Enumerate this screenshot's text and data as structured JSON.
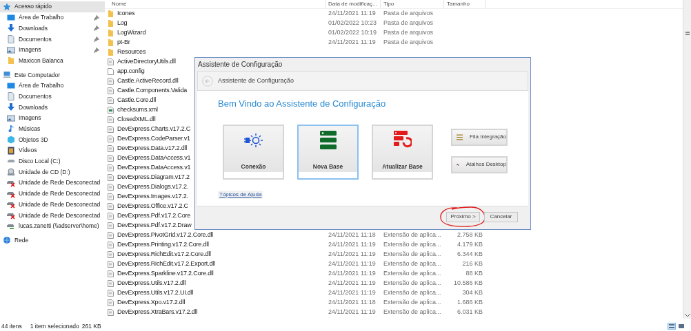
{
  "sidebar": {
    "items": [
      {
        "label": "Acesso rápido",
        "kind": "star",
        "selected": true,
        "children": [
          {
            "label": "Área de Trabalho",
            "kind": "desktop",
            "pinned": true,
            "selected": false
          },
          {
            "label": "Downloads",
            "kind": "download",
            "pinned": true,
            "selected": false
          },
          {
            "label": "Documentos",
            "kind": "document",
            "pinned": true,
            "selected": false
          },
          {
            "label": "Imagens",
            "kind": "image",
            "pinned": true,
            "selected": false
          },
          {
            "label": "Maxicon Balanca",
            "kind": "folder",
            "pinned": false,
            "selected": false
          }
        ]
      },
      {
        "label": "Este Computador",
        "kind": "computer",
        "selected": false,
        "children": [
          {
            "label": "Área de Trabalho",
            "kind": "desktop",
            "selected": false
          },
          {
            "label": "Documentos",
            "kind": "document",
            "selected": false
          },
          {
            "label": "Downloads",
            "kind": "download",
            "selected": false
          },
          {
            "label": "Imagens",
            "kind": "image",
            "selected": false
          },
          {
            "label": "Músicas",
            "kind": "music",
            "selected": false
          },
          {
            "label": "Objetos 3D",
            "kind": "cube",
            "selected": false
          },
          {
            "label": "Vídeos",
            "kind": "video",
            "selected": false
          },
          {
            "label": "Disco Local (C:)",
            "kind": "disk",
            "selected": false
          },
          {
            "label": "Unidade de CD (D:)",
            "kind": "cd",
            "selected": false
          },
          {
            "label": "Unidade de Rede Desconectad",
            "kind": "netdrive-off",
            "selected": false
          },
          {
            "label": "Unidade de Rede Desconectad",
            "kind": "netdrive-off",
            "selected": false
          },
          {
            "label": "Unidade de Rede Desconectad",
            "kind": "netdrive-off",
            "selected": false
          },
          {
            "label": "Unidade de Rede Desconectad",
            "kind": "netdrive-off",
            "selected": false
          },
          {
            "label": "lucas.zanetti (\\\\adserver\\home)",
            "kind": "netdrive",
            "selected": false
          }
        ]
      },
      {
        "label": "Rede",
        "kind": "network",
        "selected": false
      }
    ]
  },
  "table": {
    "columns": [
      "Nome",
      "Data de modificaç...",
      "Tipo",
      "Tamanho"
    ],
    "rows": [
      {
        "kind": "folder",
        "name": "Icones",
        "date": "24/11/2021 11:19",
        "type": "Pasta de arquivos"
      },
      {
        "kind": "folder",
        "name": "Log",
        "date": "01/02/2022 10:23",
        "type": "Pasta de arquivos"
      },
      {
        "kind": "folder",
        "name": "LogWizard",
        "date": "01/02/2022 10:19",
        "type": "Pasta de arquivos"
      },
      {
        "kind": "folder",
        "name": "pt-Br",
        "date": "24/11/2021 11:19",
        "type": "Pasta de arquivos"
      },
      {
        "kind": "folder",
        "name": "Resources"
      },
      {
        "kind": "dll",
        "name": "ActiveDirectoryUtils.dll"
      },
      {
        "kind": "file",
        "name": "app.config"
      },
      {
        "kind": "dll",
        "name": "Castle.ActiveRecord.dll"
      },
      {
        "kind": "dll",
        "name": "Castle.Components.Valida"
      },
      {
        "kind": "dll",
        "name": "Castle.Core.dll"
      },
      {
        "kind": "xml",
        "name": "checksums.xml"
      },
      {
        "kind": "dll",
        "name": "ClosedXML.dll"
      },
      {
        "kind": "dll",
        "name": "DevExpress.Charts.v17.2.C"
      },
      {
        "kind": "dll",
        "name": "DevExpress.CodeParser.v1"
      },
      {
        "kind": "dll",
        "name": "DevExpress.Data.v17.2.dll"
      },
      {
        "kind": "dll",
        "name": "DevExpress.DataAccess.v1"
      },
      {
        "kind": "dll",
        "name": "DevExpress.DataAccess.v1"
      },
      {
        "kind": "dll",
        "name": "DevExpress.Diagram.v17.2"
      },
      {
        "kind": "dll",
        "name": "DevExpress.Dialogs.v17.2."
      },
      {
        "kind": "dll",
        "name": "DevExpress.Images.v17.2."
      },
      {
        "kind": "dll",
        "name": "DevExpress.Office.v17.2.C"
      },
      {
        "kind": "dll",
        "name": "DevExpress.Pdf.v17.2.Core"
      },
      {
        "kind": "dll",
        "name": "DevExpress.Pdf.v17.2.Draw"
      },
      {
        "kind": "dll",
        "name": "DevExpress.PivotGrid.v17.2.Core.dll",
        "date": "24/11/2021 11:18",
        "type": "Extensão de aplica...",
        "size": "2.758 KB"
      },
      {
        "kind": "dll",
        "name": "DevExpress.Printing.v17.2.Core.dll",
        "date": "24/11/2021 11:19",
        "type": "Extensão de aplica...",
        "size": "4.179 KB"
      },
      {
        "kind": "dll",
        "name": "DevExpress.RichEdit.v17.2.Core.dll",
        "date": "24/11/2021 11:19",
        "type": "Extensão de aplica...",
        "size": "6.344 KB"
      },
      {
        "kind": "dll",
        "name": "DevExpress.RichEdit.v17.2.Export.dll",
        "date": "24/11/2021 11:19",
        "type": "Extensão de aplica...",
        "size": "216 KB"
      },
      {
        "kind": "dll",
        "name": "DevExpress.Sparkline.v17.2.Core.dll",
        "date": "24/11/2021 11:19",
        "type": "Extensão de aplica...",
        "size": "88 KB"
      },
      {
        "kind": "dll",
        "name": "DevExpress.Utils.v17.2.dll",
        "date": "24/11/2021 11:19",
        "type": "Extensão de aplica...",
        "size": "10.586 KB"
      },
      {
        "kind": "dll",
        "name": "DevExpress.Utils.v17.2.UI.dll",
        "date": "24/11/2021 11:19",
        "type": "Extensão de aplica...",
        "size": "304 KB"
      },
      {
        "kind": "dll",
        "name": "DevExpress.Xpo.v17.2.dll",
        "date": "24/11/2021 11:18",
        "type": "Extensão de aplica...",
        "size": "1.686 KB"
      },
      {
        "kind": "dll",
        "name": "DevExpress.XtraBars.v17.2.dll",
        "date": "24/11/2021 11:19",
        "type": "Extensão de aplica...",
        "size": "6.031 KB"
      }
    ]
  },
  "status_bar": {
    "count": "44 itens",
    "selection": "1 item selecionado",
    "size": "261 KB",
    "views": [
      {
        "kind": "details",
        "selected": true
      },
      {
        "kind": "tiles",
        "selected": false
      }
    ]
  },
  "dialog": {
    "title": "Assistente de Configuração",
    "nav_title": "Assistente de Configuração",
    "heading": "Bem Vindo ao Assistente de Configuração",
    "tiles": [
      {
        "kind": "connection",
        "label": "Conexão",
        "selected": false
      },
      {
        "kind": "database",
        "label": "Nova Base",
        "selected": true
      },
      {
        "kind": "database-update",
        "label": "Atualizar Base",
        "selected": false
      }
    ],
    "side_buttons": [
      {
        "kind": "list",
        "label": "Fila Integração"
      },
      {
        "kind": "shortcut",
        "label": "Atalhos Desktop"
      }
    ],
    "help_link": "Tópicos de Ajuda",
    "buttons": [
      {
        "label": "Próximo >",
        "circled": true
      },
      {
        "label": "Cancelar",
        "circled": false
      }
    ]
  }
}
